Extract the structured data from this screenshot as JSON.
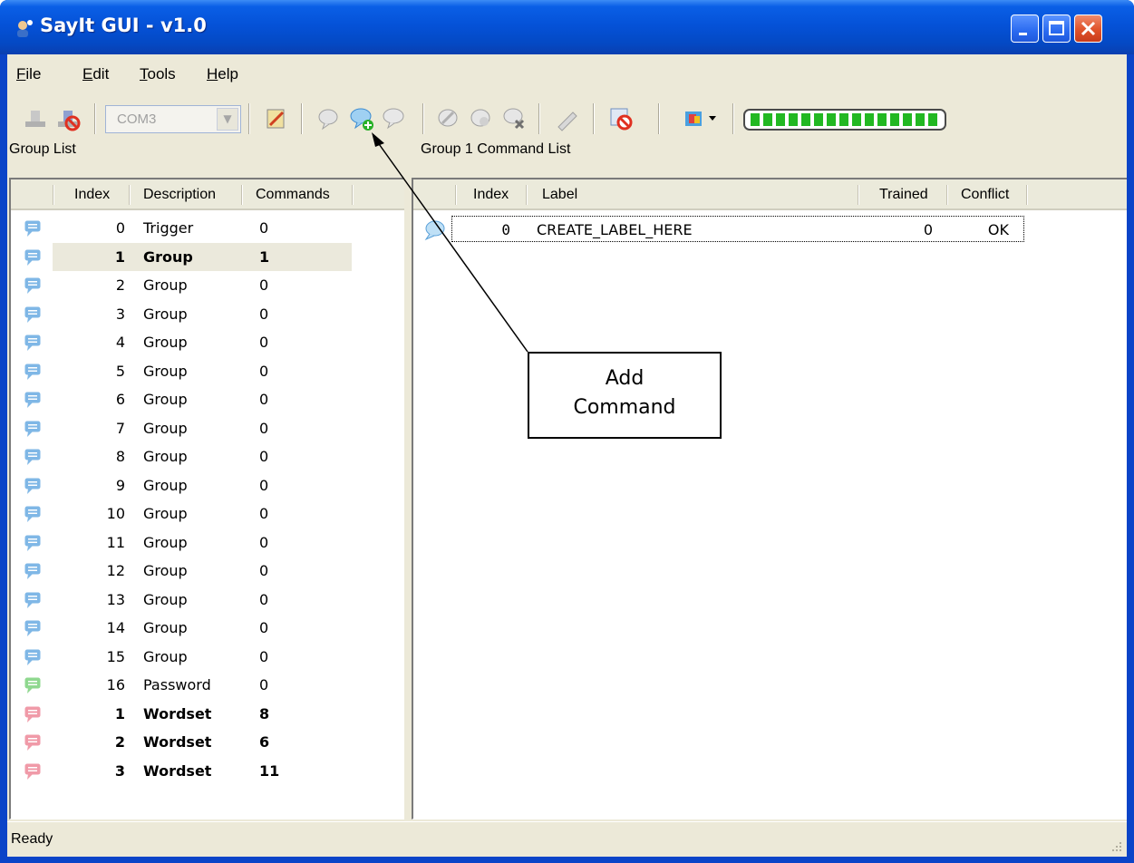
{
  "window": {
    "title": "SayIt GUI - v1.0"
  },
  "menu": [
    {
      "pre": "",
      "u": "F",
      "post": "ile"
    },
    {
      "pre": "",
      "u": "E",
      "post": "dit"
    },
    {
      "pre": "",
      "u": "T",
      "post": "ools"
    },
    {
      "pre": "",
      "u": "H",
      "post": "elp"
    }
  ],
  "toolbar": {
    "port": "COM3",
    "icons": [
      "connect-icon",
      "disconnect-icon",
      "settings-icon",
      "add-group-icon",
      "add-command-icon",
      "remove-command-icon",
      "train-icon",
      "test-icon",
      "erase-icon",
      "rename-icon",
      "stop-icon",
      "color-icon"
    ],
    "level_segments": 15
  },
  "group_list": {
    "title": "Group List",
    "columns": [
      "Index",
      "Description",
      "Commands"
    ],
    "rows": [
      {
        "index": "0",
        "description": "Trigger",
        "commands": "0",
        "color": "#7fb7e6",
        "bold": false,
        "selected": false
      },
      {
        "index": "1",
        "description": "Group",
        "commands": "1",
        "color": "#7fb7e6",
        "bold": true,
        "selected": true
      },
      {
        "index": "2",
        "description": "Group",
        "commands": "0",
        "color": "#7fb7e6",
        "bold": false,
        "selected": false
      },
      {
        "index": "3",
        "description": "Group",
        "commands": "0",
        "color": "#7fb7e6",
        "bold": false,
        "selected": false
      },
      {
        "index": "4",
        "description": "Group",
        "commands": "0",
        "color": "#7fb7e6",
        "bold": false,
        "selected": false
      },
      {
        "index": "5",
        "description": "Group",
        "commands": "0",
        "color": "#7fb7e6",
        "bold": false,
        "selected": false
      },
      {
        "index": "6",
        "description": "Group",
        "commands": "0",
        "color": "#7fb7e6",
        "bold": false,
        "selected": false
      },
      {
        "index": "7",
        "description": "Group",
        "commands": "0",
        "color": "#7fb7e6",
        "bold": false,
        "selected": false
      },
      {
        "index": "8",
        "description": "Group",
        "commands": "0",
        "color": "#7fb7e6",
        "bold": false,
        "selected": false
      },
      {
        "index": "9",
        "description": "Group",
        "commands": "0",
        "color": "#7fb7e6",
        "bold": false,
        "selected": false
      },
      {
        "index": "10",
        "description": "Group",
        "commands": "0",
        "color": "#7fb7e6",
        "bold": false,
        "selected": false
      },
      {
        "index": "11",
        "description": "Group",
        "commands": "0",
        "color": "#7fb7e6",
        "bold": false,
        "selected": false
      },
      {
        "index": "12",
        "description": "Group",
        "commands": "0",
        "color": "#7fb7e6",
        "bold": false,
        "selected": false
      },
      {
        "index": "13",
        "description": "Group",
        "commands": "0",
        "color": "#7fb7e6",
        "bold": false,
        "selected": false
      },
      {
        "index": "14",
        "description": "Group",
        "commands": "0",
        "color": "#7fb7e6",
        "bold": false,
        "selected": false
      },
      {
        "index": "15",
        "description": "Group",
        "commands": "0",
        "color": "#7fb7e6",
        "bold": false,
        "selected": false
      },
      {
        "index": "16",
        "description": "Password",
        "commands": "0",
        "color": "#8fd88f",
        "bold": false,
        "selected": false
      },
      {
        "index": "1",
        "description": "Wordset",
        "commands": "8",
        "color": "#f09aa8",
        "bold": true,
        "selected": false
      },
      {
        "index": "2",
        "description": "Wordset",
        "commands": "6",
        "color": "#f09aa8",
        "bold": true,
        "selected": false
      },
      {
        "index": "3",
        "description": "Wordset",
        "commands": "11",
        "color": "#f09aa8",
        "bold": true,
        "selected": false
      }
    ]
  },
  "command_list": {
    "title": "Group 1 Command List",
    "columns": [
      "Index",
      "Label",
      "Trained",
      "Conflict"
    ],
    "rows": [
      {
        "index": "0",
        "label": "CREATE_LABEL_HERE",
        "trained": "0",
        "conflict": "OK"
      }
    ]
  },
  "status": "Ready",
  "callout": {
    "line1": "Add",
    "line2": "Command"
  }
}
